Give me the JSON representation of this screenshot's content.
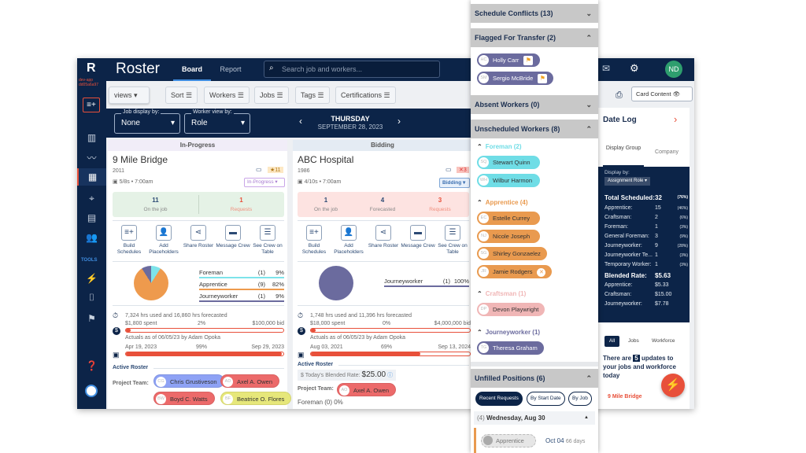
{
  "app": {
    "logo": "R",
    "env": "dev-app dd05a6a97",
    "title": "Roster",
    "tabs": [
      "Board",
      "Report"
    ],
    "search_placeholder": "Search job and workers...",
    "avatar": "ND",
    "avatar_color": "#2e9e6e",
    "brand_color": "#0c2448",
    "accent": "#e8503a"
  },
  "sidebar": {
    "tools_label": "TOOLS",
    "icons": [
      "add-schedule-icon",
      "bar-chart-icon",
      "trend-icon",
      "table-icon",
      "map-pin-icon",
      "building-icon",
      "people-icon",
      "lightning-icon",
      "radio-icon",
      "flag-icon",
      "help-icon",
      "user-avatar-icon"
    ]
  },
  "toolbar": {
    "views": "views",
    "filters": [
      "Sort",
      "Workers",
      "Jobs",
      "Tags",
      "Certifications"
    ]
  },
  "datebar": {
    "job_display_label": "Job display by:",
    "job_display_value": "None",
    "worker_view_label": "Worker view by:",
    "worker_view_value": "Role",
    "day": "THURSDAY",
    "date": "SEPTEMBER 28, 2023"
  },
  "columns": [
    "In-Progress",
    "Bidding"
  ],
  "actions": [
    "Build Schedules",
    "Add Placeholders",
    "Share Roster",
    "Message Crew",
    "See Crew on Table"
  ],
  "cards": [
    {
      "title": "9 Mile Bridge",
      "year": "2011",
      "schedule": "5/8s • 7:00am",
      "badge": "11",
      "status": "In-Progress",
      "stats": [
        {
          "value": "11",
          "label": "On the job"
        },
        {
          "value": "1",
          "label": "Requests"
        }
      ],
      "legend": [
        {
          "name": "Foreman",
          "count": "(1)",
          "pct": "9%",
          "value": 9,
          "color": "#7de3ea"
        },
        {
          "name": "Apprentice",
          "count": "(9)",
          "pct": "82%",
          "value": 82,
          "color": "#ee9a4d"
        },
        {
          "name": "Journeyworker",
          "count": "(1)",
          "pct": "9%",
          "value": 9,
          "color": "#6b6b9e"
        }
      ],
      "hours": "7,324 hrs used and 16,860 hrs forecasted",
      "spent": "$1,800 spent",
      "spent_pct": "2%",
      "bid": "$100,000 bid",
      "budget_progress": 2,
      "actuals": "Actuals as of 06/05/23 by Adam Opoka",
      "start": "Apr 19, 2023",
      "time_pct": "99%",
      "end": "Sep 29, 2023",
      "time_progress": 99,
      "active_roster": "Active Roster",
      "project_team_label": "Project Team:",
      "team": [
        {
          "initials": "CG",
          "name": "Chris Grustiveson",
          "color": "#8ea2f5"
        },
        {
          "initials": "AD",
          "name": "Axel A. Owen",
          "color": "#ec6a6a"
        },
        {
          "initials": "BW",
          "name": "Boyd C. Watts",
          "color": "#ec6a6a"
        },
        {
          "initials": "BF",
          "name": "Beatrice O. Flores",
          "color": "#e6e77a"
        }
      ]
    },
    {
      "title": "ABC Hospital",
      "year": "1986",
      "schedule": "4/10s • 7:00am",
      "badge": "3",
      "status": "Bidding",
      "stats": [
        {
          "value": "1",
          "label": "On the job"
        },
        {
          "value": "4",
          "label": "Forecasted"
        },
        {
          "value": "3",
          "label": "Requests"
        }
      ],
      "legend": [
        {
          "name": "Journeyworker",
          "count": "(1)",
          "pct": "100%",
          "value": 100,
          "color": "#6b6b9e"
        }
      ],
      "hours": "1,748 hrs used and 11,396 hrs forecasted",
      "spent": "$18,000 spent",
      "spent_pct": "0%",
      "bid": "$4,000,000 bid",
      "budget_progress": 0,
      "actuals": "Actuals as of 06/05/23 by Adam Opoka",
      "start": "Aug 03, 2021",
      "time_pct": "69%",
      "end": "Sep 13, 2024",
      "time_progress": 69,
      "active_roster": "Active Roster",
      "blended_label": "Today's Blended Rate:",
      "blended_value": "$25.00",
      "project_team_label": "Project Team:",
      "next_row": "Foreman (0) 0%",
      "team": [
        {
          "initials": "AO",
          "name": "Axel A. Owen",
          "color": "#ec6a6a"
        }
      ]
    }
  ],
  "overlay": {
    "schedule_conflicts": "Schedule Conflicts (13)",
    "flagged": "Flagged For Transfer (2)",
    "flagged_workers": [
      {
        "initials": "HC",
        "name": "Holly Carr"
      },
      {
        "initials": "SM",
        "name": "Sergio McBride"
      }
    ],
    "absent": "Absent Workers (0)",
    "unscheduled": "Unscheduled Workers (8)",
    "groups": [
      {
        "label": "Foreman (2)",
        "color": "#6fdde6",
        "workers": [
          {
            "initials": "SQ",
            "name": "Stewart Quinn"
          },
          {
            "initials": "WH",
            "name": "Wilbur Harmon"
          }
        ]
      },
      {
        "label": "Apprentice (4)",
        "color": "#e99a4f",
        "workers": [
          {
            "initials": "EC",
            "name": "Estelle Currey"
          },
          {
            "initials": "NJ",
            "name": "Nicole Joseph"
          },
          {
            "initials": "SG",
            "name": "Shirley Gonzaelez"
          },
          {
            "initials": "JR",
            "name": "Jamie Rodgers"
          }
        ]
      },
      {
        "label": "Craftsman (1)",
        "color": "#f0b6b6",
        "workers": [
          {
            "initials": "DP",
            "name": "Devon Playwright"
          }
        ]
      },
      {
        "label": "Journeyworker (1)",
        "color": "#6b6b9e",
        "workers": [
          {
            "initials": "TG",
            "name": "Theresa Graham"
          }
        ]
      }
    ],
    "unfilled": "Unfilled Positions (6)",
    "unfilled_tabs": [
      "Recent Requests",
      "By Start Date",
      "By Job"
    ],
    "date_group_count": "(4)",
    "date_group": "Wednesday, Aug 30",
    "position_role": "Apprentice",
    "position_date": "Oct 04",
    "position_days": "66 days"
  },
  "right": {
    "card_content": "Card Content",
    "date_log": "Date Log",
    "tabs": [
      "Display Group",
      "Company"
    ],
    "display_by_label": "Display by:",
    "display_by_value": "Assignment Role",
    "total_label": "Total Scheduled:",
    "total_value": "32",
    "total_pct": "(76%)",
    "rows": [
      {
        "label": "Apprentice:",
        "value": "15",
        "pct": "(46%)"
      },
      {
        "label": "Craftsman:",
        "value": "2",
        "pct": "(6%)"
      },
      {
        "label": "Foreman:",
        "value": "1",
        "pct": "(3%)"
      },
      {
        "label": "General Foreman:",
        "value": "3",
        "pct": "(9%)"
      },
      {
        "label": "Journeyworker:",
        "value": "9",
        "pct": "(28%)"
      },
      {
        "label": "Journeyworker Te...",
        "value": "1",
        "pct": "(3%)"
      },
      {
        "label": "Temporary Worker:",
        "value": "1",
        "pct": "(3%)"
      }
    ],
    "blended_label": "Blended Rate:",
    "blended_value": "$5.63",
    "rates": [
      {
        "label": "Apprentice:",
        "value": "$5.33"
      },
      {
        "label": "Craftsman:",
        "value": "$15.00"
      },
      {
        "label": "Journeyworker:",
        "value": "$7.78"
      }
    ],
    "feed_tabs": [
      "All",
      "Jobs",
      "Workforce"
    ],
    "updates_pre": "There are",
    "updates_count": "5",
    "updates_post": "updates to your jobs and workforce today",
    "feed_item": "9 Mile Bridge"
  }
}
